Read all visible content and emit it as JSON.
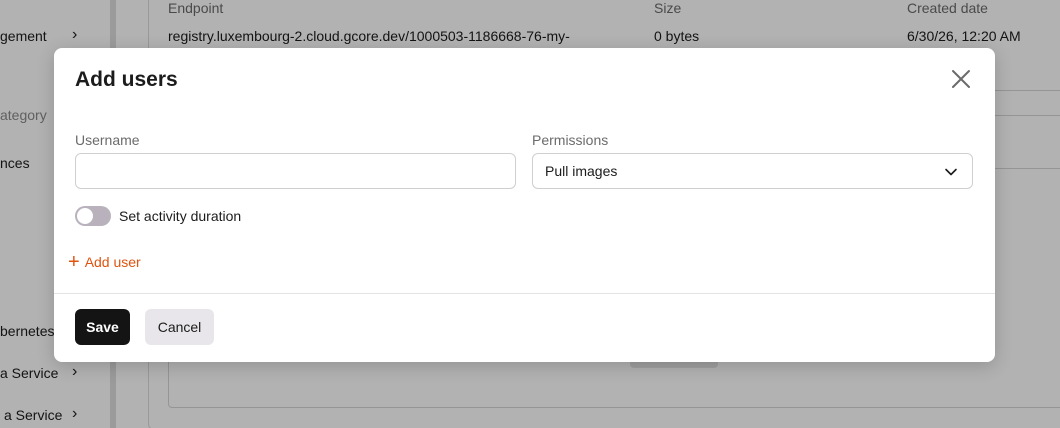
{
  "background": {
    "sidebar": {
      "items": [
        {
          "label": "gement",
          "chevron": "›"
        },
        {
          "label": "ategory",
          "type": "category"
        },
        {
          "label": "nces"
        },
        {
          "label": "bernetes"
        },
        {
          "label": "a Service",
          "chevron": "›"
        },
        {
          "label": "a Service",
          "chevron": "›"
        }
      ]
    },
    "table": {
      "columns": [
        "Endpoint",
        "Size",
        "Created date"
      ],
      "row": {
        "endpoint": "registry.luxembourg-2.cloud.gcore.dev/1000503-1186668-76-my-",
        "size": "0 bytes",
        "created": "6/30/26, 12:20 AM"
      }
    }
  },
  "modal": {
    "title": "Add users",
    "username_label": "Username",
    "username_value": "",
    "permissions_label": "Permissions",
    "permissions_value": "Pull images",
    "toggle_label": "Set activity duration",
    "toggle_on": false,
    "add_user_label": "Add user",
    "add_user_icon": "+",
    "save_label": "Save",
    "cancel_label": "Cancel"
  },
  "colors": {
    "accent": "#e0530f",
    "primary_button": "#141414",
    "secondary_button": "#e8e6ea",
    "toggle_off": "#b9b2bd"
  },
  "icons": [
    "close-icon",
    "chevron-down-icon",
    "plus-icon",
    "chevron-right-icon"
  ]
}
